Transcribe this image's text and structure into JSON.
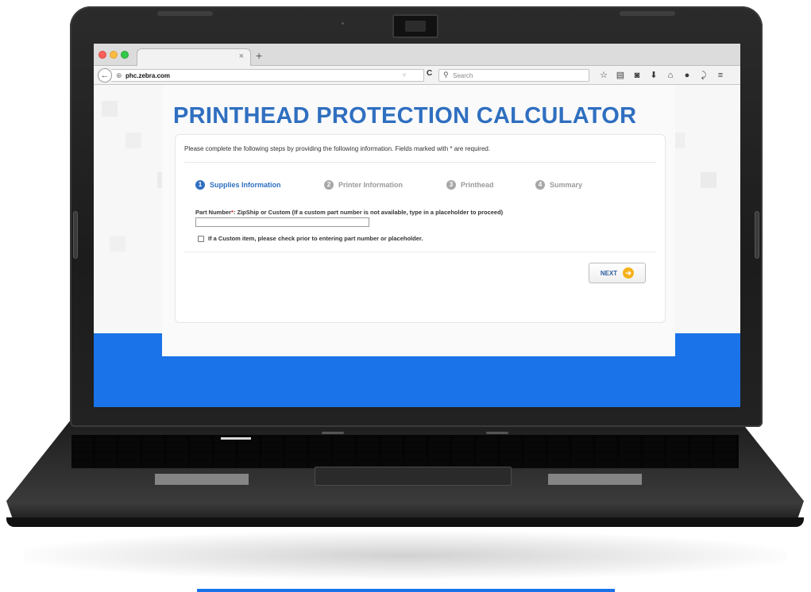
{
  "browser": {
    "tab_close": "×",
    "tab_new": "+",
    "back_glyph": "←",
    "url_domain": "phc.zebra.com",
    "reload_glyph": "C",
    "search_placeholder": "Search",
    "toolbar_icons": [
      "star-icon",
      "bookmarks-icon",
      "pocket-icon",
      "download-icon",
      "home-icon",
      "chat-icon",
      "extension-icon",
      "menu-icon"
    ]
  },
  "page": {
    "title": "PRINTHEAD PROTECTION CALCULATOR",
    "instructions": "Please complete the following steps by providing the following information. Fields marked with * are required.",
    "steps": [
      {
        "num": "1",
        "label": "Supplies Information",
        "active": true
      },
      {
        "num": "2",
        "label": "Printer Information",
        "active": false
      },
      {
        "num": "3",
        "label": "Printhead",
        "active": false
      },
      {
        "num": "4",
        "label": "Summary",
        "active": false
      }
    ],
    "part_number_label": "Part Number",
    "part_number_required": "*",
    "part_number_hint": ": ZipShip or Custom (If a custom part number is not available, type in a placeholder to proceed)",
    "part_number_value": "",
    "custom_checkbox_label": "If a Custom item, please check prior to entering part number or placeholder.",
    "custom_checked": false,
    "next_label": "NEXT"
  },
  "colors": {
    "brand_blue": "#2f6fc0",
    "band_blue": "#1a73e8",
    "next_arrow": "#f5b21a",
    "required_red": "#d62b2b"
  }
}
